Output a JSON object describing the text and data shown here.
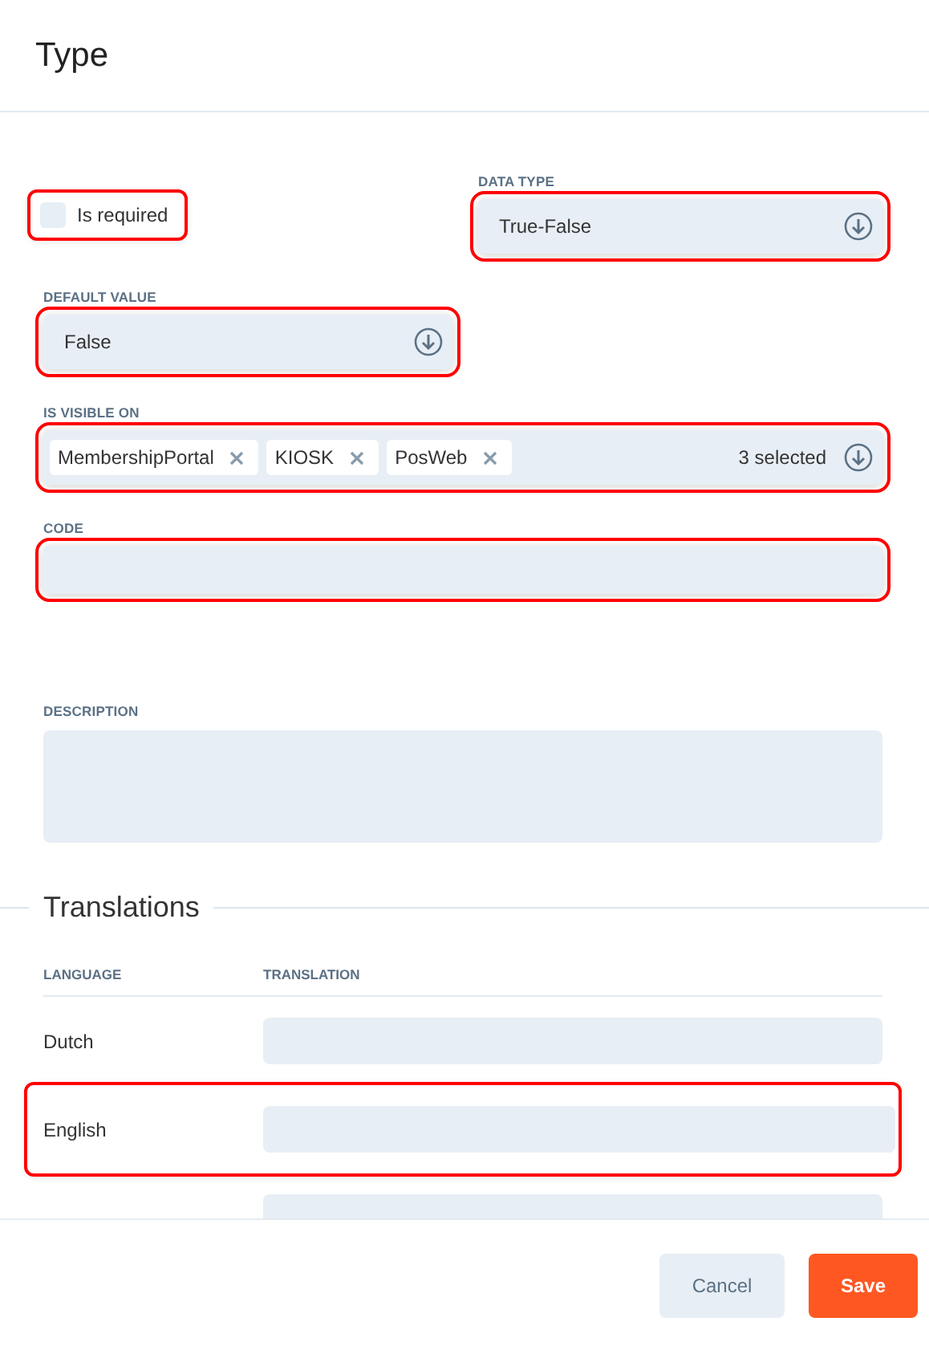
{
  "title": "Type",
  "is_required": {
    "label": "Is required",
    "checked": false,
    "highlighted": true
  },
  "data_type": {
    "label": "DATA TYPE",
    "value": "True-False",
    "highlighted": true
  },
  "default_value": {
    "label": "DEFAULT VALUE",
    "value": "False",
    "highlighted": true
  },
  "is_visible_on": {
    "label": "IS VISIBLE ON",
    "tags": [
      "MembershipPortal",
      "KIOSK",
      "PosWeb"
    ],
    "summary": "3 selected",
    "highlighted": true
  },
  "code": {
    "label": "CODE",
    "highlighted": true
  },
  "description": {
    "label": "DESCRIPTION",
    "highlighted": false
  },
  "translations": {
    "title": "Translations",
    "columns": [
      "LANGUAGE",
      "TRANSLATION"
    ],
    "rows": [
      {
        "kind": "row",
        "language": "Dutch",
        "highlighted": false
      },
      {
        "kind": "row",
        "language": "English",
        "highlighted": true
      },
      {
        "kind": "clipped",
        "highlighted": false
      }
    ]
  },
  "buttons": [
    {
      "kind": "secondary",
      "label": "Cancel"
    },
    {
      "kind": "primary",
      "label": "Save"
    }
  ]
}
